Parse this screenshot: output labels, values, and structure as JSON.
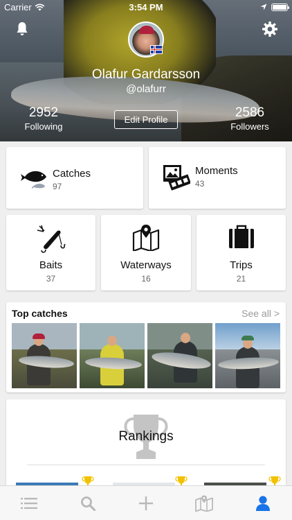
{
  "status_bar": {
    "carrier": "Carrier",
    "time": "3:54 PM"
  },
  "profile": {
    "name": "Olafur Gardarsson",
    "handle": "@olafurr",
    "following_count": "2952",
    "following_label": "Following",
    "followers_count": "2586",
    "followers_label": "Followers",
    "edit_button": "Edit Profile"
  },
  "sections": {
    "catches": {
      "label": "Catches",
      "count": "97"
    },
    "moments": {
      "label": "Moments",
      "count": "43"
    },
    "baits": {
      "label": "Baits",
      "count": "37"
    },
    "waterways": {
      "label": "Waterways",
      "count": "16"
    },
    "trips": {
      "label": "Trips",
      "count": "21"
    }
  },
  "top_catches": {
    "title": "Top catches",
    "see_all": "See all >"
  },
  "rankings": {
    "title": "Rankings"
  },
  "tab_bar": {
    "items": [
      "feed-icon",
      "search-icon",
      "add-icon",
      "map-icon",
      "profile-icon"
    ],
    "active_color": "#1a73e8",
    "inactive_color": "#b9b9b9"
  },
  "colors": {
    "accent": "#1a73e8",
    "trophy": "#f2c200"
  }
}
